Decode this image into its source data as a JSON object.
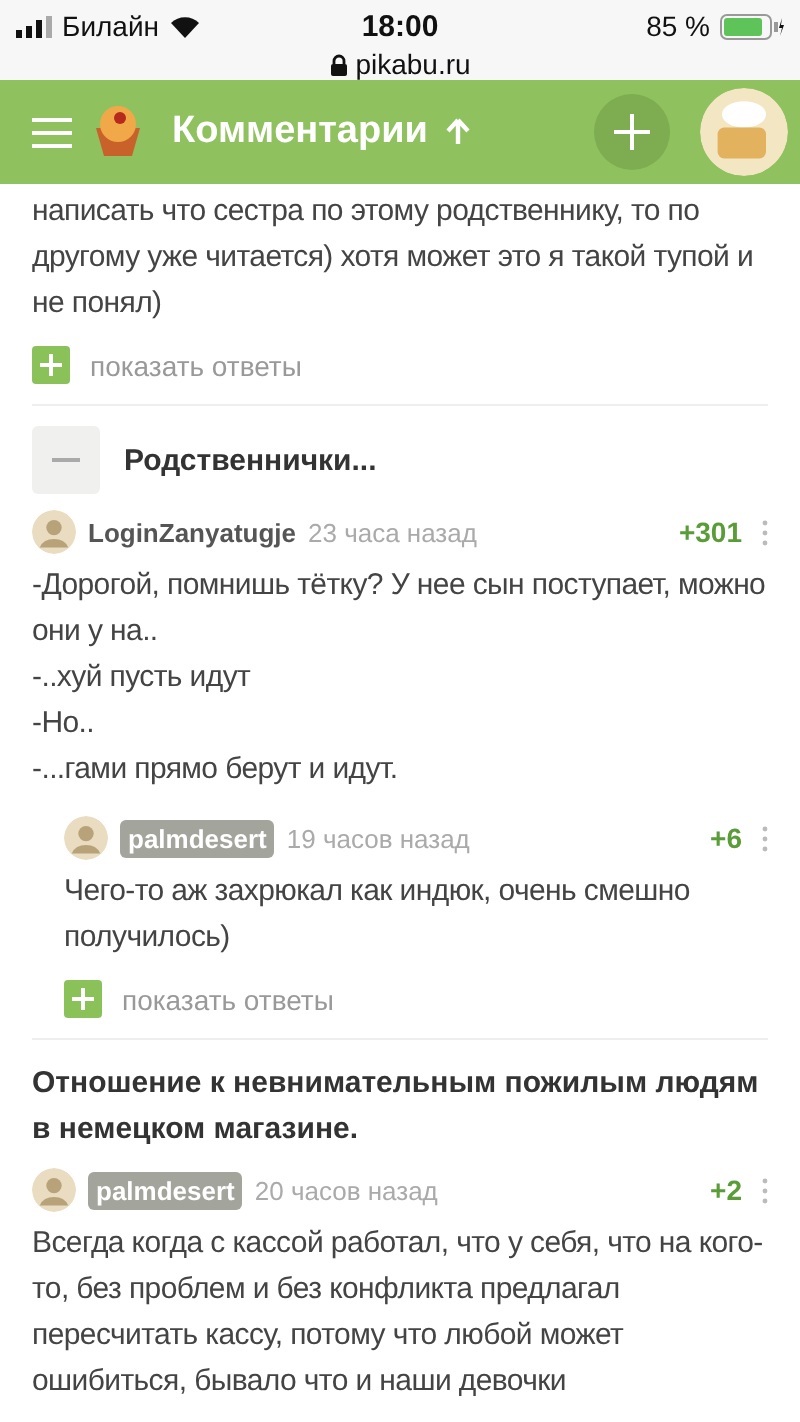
{
  "status_bar": {
    "carrier": "Билайн",
    "time": "18:00",
    "url": "pikabu.ru",
    "battery": "85 %"
  },
  "header": {
    "title": "Комментарии"
  },
  "feed": [
    {
      "kind": "comment_tail",
      "lines": [
        "написать что сестра по этому родственнику, то по другому уже читается) хотя может это я такой тупой и не понял)"
      ],
      "show_replies": "показать ответы"
    },
    {
      "kind": "post",
      "title": "Родственнички...",
      "collapsible": true,
      "comments": [
        {
          "author": "LoginZanyatugje",
          "author_tag": false,
          "time": "23 часа назад",
          "rating": "+301",
          "lines": [
            "-Дорогой, помнишь тётку? У нее сын поступает, можно они у на..",
            "-..хуй пусть идут",
            "-Но..",
            "-...гами прямо берут и идут."
          ],
          "children": [
            {
              "author": "palmdesert",
              "author_tag": true,
              "time": "19 часов назад",
              "rating": "+6",
              "lines": [
                "Чего-то аж захрюкал как индюк, очень смешно получилось)"
              ],
              "show_replies": "показать ответы"
            }
          ]
        }
      ]
    },
    {
      "kind": "post",
      "title": "Отношение к невнимательным пожилым людям в немецком магазине.",
      "collapsible": false,
      "comments": [
        {
          "author": "palmdesert",
          "author_tag": true,
          "time": "20 часов назад",
          "rating": "+2",
          "lines": [
            "Всегда когда с кассой работал, что у себя, что на кого-то, без проблем и без конфликта предлагал пересчитать кассу, потому что любой может ошибиться, бывало что и наши девочки"
          ]
        }
      ]
    }
  ]
}
